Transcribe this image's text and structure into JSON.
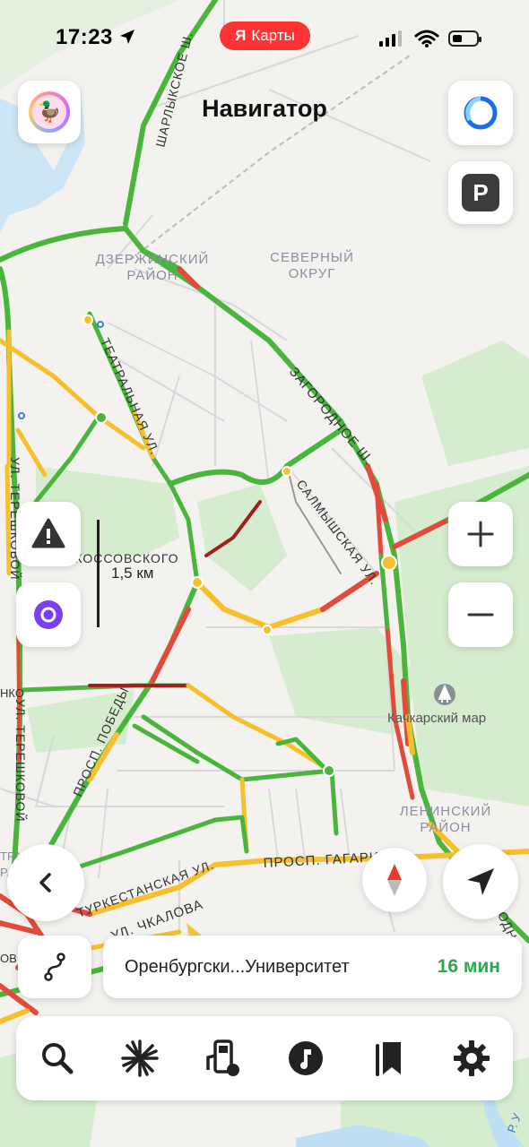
{
  "status": {
    "time": "17:23",
    "app_pill_logo": "Я",
    "app_pill_label": "Карты"
  },
  "header": {
    "title": "Навигатор"
  },
  "map": {
    "labels": {
      "dzerzhinsky_1": "ДЗЕРЖИНСКИЙ",
      "dzerzhinsky_2": "РАЙОН",
      "severny_1": "СЕВЕРНЫЙ",
      "severny_2": "ОКРУГ",
      "leninsky_1": "ЛЕНИНСКИЙ",
      "leninsky_2": "РАЙОН",
      "sharlykskoe": "ШАРЛЫКСКОЕ Ш.",
      "zagorodnoe": "ЗАГОРОДНОЕ Ш.",
      "teatralnaya": "ТЕАТРАЛЬНАЯ УЛ.",
      "salmyshskaya": "САЛМЫШСКАЯ УЛ.",
      "tereshkovoi_1": "УЛ. ТЕРЕШКОВОЙ",
      "tereshkovoi_2": "УЛ. ТЕРЕШКОВОЙ",
      "rokossovskogo": "УЛ. РОКОССОВСКОГО",
      "pobedy": "ПРОСП. ПОБЕДЫ",
      "turkestanskaya": "ТУРКЕСТАНСКАЯ УЛ.",
      "chkalova": "УЛ. ЧКАЛОВА",
      "gagarina": "ПРОСП. ГАГАРИНА",
      "kachkarsky": "Качкарский мар",
      "nko": "НКО",
      "tralny": "ТРАЛЬНЫЙ",
      "rayon_left": "РАЙОН",
      "orodn": "ОРОДН",
      "ov": "ОВ",
      "r_right": "Р. У"
    },
    "scale": "1,5 км"
  },
  "route": {
    "name": "Оренбургски...Университет",
    "time": "16 мин"
  },
  "icons": {
    "avatar": "duck-avatar-icon",
    "alice": "alice-icon",
    "parking": "parking-icon",
    "warning": "warning-icon",
    "zoom_in": "plus-icon",
    "zoom_out": "minus-icon",
    "back": "chevron-left-icon",
    "compass": "compass-icon",
    "navigate": "navigation-arrow-icon",
    "route": "route-icon",
    "search": "search-icon",
    "discovery": "sparkle-icon",
    "fuel": "fuel-icon",
    "music": "music-icon",
    "bookmarks": "bookmarks-icon",
    "settings": "gear-icon"
  },
  "colors": {
    "traffic_green": "#3fb33f",
    "traffic_yellow": "#f5c02b",
    "traffic_red": "#e24b3b",
    "traffic_darkred": "#a31f1f",
    "route_time": "#2aa84a",
    "ya_pill": "#ff3333"
  }
}
